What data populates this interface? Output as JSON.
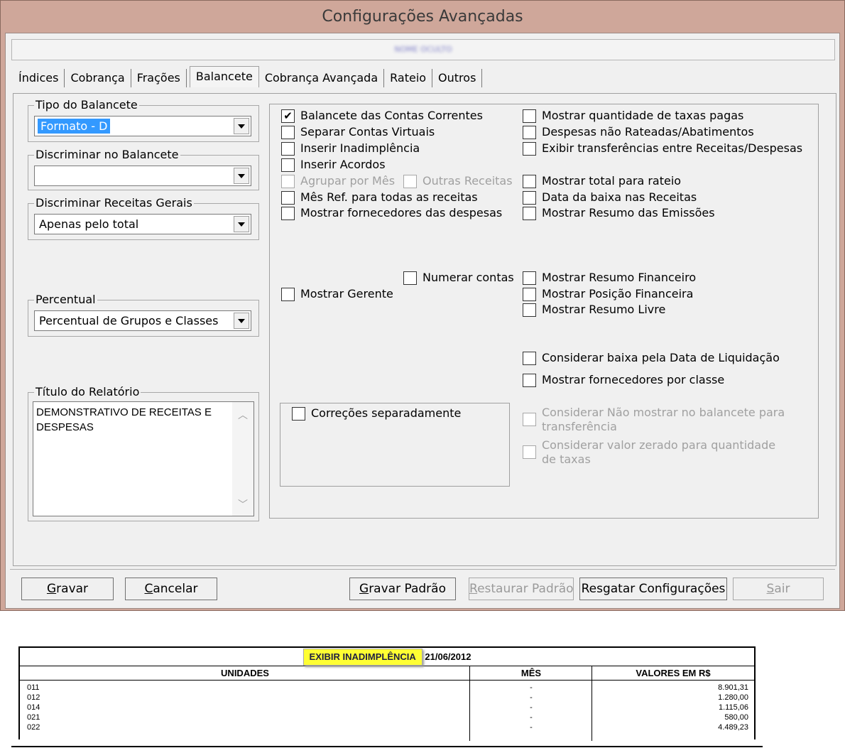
{
  "window": {
    "title": "Configurações Avançadas",
    "client_name": "NOME OCULTO"
  },
  "tabs": [
    {
      "label": "Índices"
    },
    {
      "label": "Cobrança"
    },
    {
      "label": "Frações"
    },
    {
      "label": "Balancete",
      "active": true
    },
    {
      "label": "Cobrança Avançada"
    },
    {
      "label": "Rateio"
    },
    {
      "label": "Outros"
    }
  ],
  "left": {
    "tipo_balancete": {
      "legend": "Tipo do Balancete",
      "value": "Formato - D"
    },
    "discriminar_balancete": {
      "legend": "Discriminar no Balancete",
      "value": ""
    },
    "discriminar_receitas": {
      "legend": "Discriminar Receitas Gerais",
      "value": "Apenas pelo total"
    },
    "percentual": {
      "legend": "Percentual",
      "value": "Percentual de Grupos e Classes"
    },
    "titulo_relatorio": {
      "legend": "Título do Relatório",
      "value": "DEMONSTRATIVO DE RECEITAS E DESPESAS"
    }
  },
  "checkboxes": {
    "balancete_contas_correntes": {
      "label": "Balancete das Contas Correntes",
      "checked": true
    },
    "separar_contas_virtuais": {
      "label": "Separar Contas Virtuais",
      "checked": false
    },
    "inserir_inadimplencia": {
      "label": "Inserir Inadimplência",
      "checked": false
    },
    "inserir_acordos": {
      "label": "Inserir Acordos",
      "checked": false
    },
    "agrupar_por_mes": {
      "label": "Agrupar por Mês",
      "checked": false
    },
    "outras_receitas": {
      "label": "Outras Receitas",
      "checked": false
    },
    "mes_ref_receitas": {
      "label": "Mês Ref. para todas as receitas",
      "checked": false
    },
    "mostrar_fornecedores_despesas": {
      "label": "Mostrar fornecedores das despesas",
      "checked": false
    },
    "numerar_contas": {
      "label": "Numerar contas",
      "checked": false
    },
    "mostrar_gerente": {
      "label": "Mostrar Gerente",
      "checked": false
    },
    "correcoes_separadamente": {
      "label": "Correções separadamente",
      "checked": false
    },
    "mostrar_qtd_taxas_pagas": {
      "label": "Mostrar quantidade de taxas pagas",
      "checked": false
    },
    "despesas_nao_rateadas": {
      "label": "Despesas não Rateadas/Abatimentos",
      "checked": false
    },
    "exibir_transferencias": {
      "label": "Exibir transferências entre Receitas/Despesas",
      "checked": false
    },
    "mostrar_total_rateio": {
      "label": "Mostrar total para rateio",
      "checked": false
    },
    "data_baixa_receitas": {
      "label": "Data da baixa nas Receitas",
      "checked": false
    },
    "mostrar_resumo_emissoes": {
      "label": "Mostrar Resumo das Emissões",
      "checked": false
    },
    "mostrar_resumo_financeiro": {
      "label": "Mostrar Resumo Financeiro",
      "checked": false
    },
    "mostrar_posicao_financeira": {
      "label": "Mostrar Posição Financeira",
      "checked": false
    },
    "mostrar_resumo_livre": {
      "label": "Mostrar Resumo Livre",
      "checked": false
    },
    "considerar_baixa_liquidacao": {
      "label": "Considerar baixa pela Data de Liquidação",
      "checked": false
    },
    "mostrar_fornecedores_classe": {
      "label": "Mostrar fornecedores por classe",
      "checked": false
    },
    "considerar_nao_mostrar": {
      "label": "Considerar Não mostrar no balancete para transferência",
      "checked": false
    },
    "considerar_valor_zerado": {
      "label": "Considerar valor zerado para quantidade de taxas",
      "checked": false
    }
  },
  "buttons": {
    "gravar": {
      "prefix": "G",
      "rest": "ravar"
    },
    "cancelar": {
      "prefix": "C",
      "rest": "ancelar"
    },
    "gravar_padrao": {
      "prefix": "G",
      "rest": "ravar Padrão"
    },
    "restaurar_padrao": {
      "prefix": "R",
      "rest": "estaurar Padrão"
    },
    "resgatar_config": {
      "label": "Resgatar Configurações"
    },
    "sair": {
      "prefix": "S",
      "rest": "air"
    }
  },
  "report": {
    "highlight": "EXIBIR INADIMPLÊNCIA",
    "date": "21/06/2012",
    "headers": {
      "unidades": "UNIDADES",
      "mes": "MÊS",
      "valores": "VALORES EM R$"
    },
    "rows": [
      {
        "unidade": "011",
        "mes": "-",
        "valor": "8.901,31"
      },
      {
        "unidade": "012",
        "mes": "-",
        "valor": "1.280,00"
      },
      {
        "unidade": "014",
        "mes": "-",
        "valor": "1.115,06"
      },
      {
        "unidade": "021",
        "mes": "-",
        "valor": "580,00"
      },
      {
        "unidade": "022",
        "mes": "-",
        "valor": "4.489,23"
      }
    ]
  }
}
